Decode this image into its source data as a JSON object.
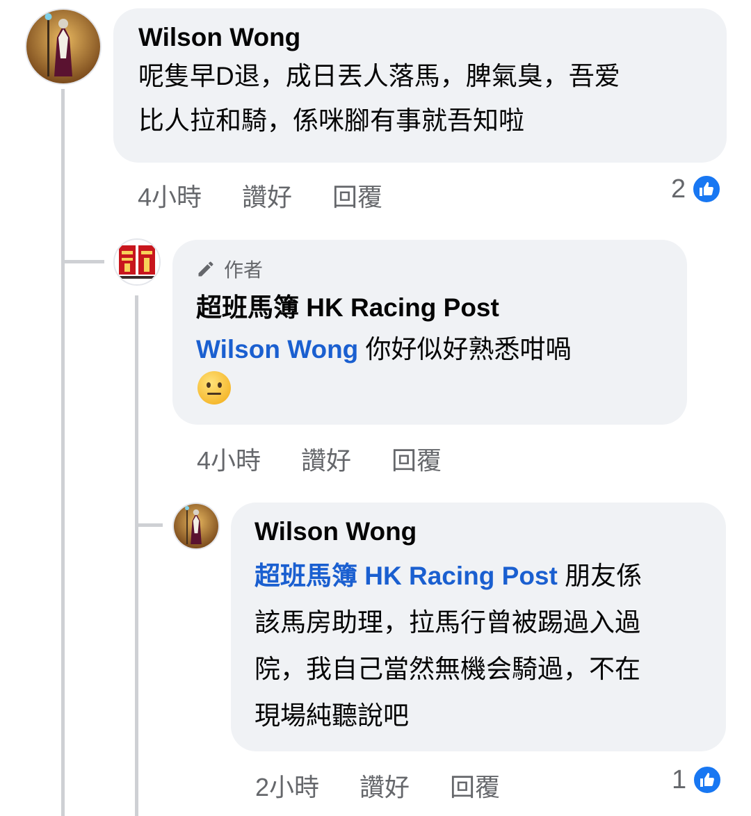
{
  "comment1": {
    "author": "Wilson Wong",
    "text_line1": "呢隻早D退，成日丟人落馬，脾氣臭，吾爱",
    "text_line2": "比人拉和騎，係咪腳有事就吾知啦",
    "time": "4小時",
    "like_label": "讚好",
    "reply_label": "回覆",
    "reaction_count": "2"
  },
  "reply1": {
    "author_badge": "作者",
    "author": "超班馬簿 HK Racing Post",
    "mention": "Wilson Wong",
    "text": " 你好似好熟悉咁喎",
    "emoji": "neutral-face",
    "time": "4小時",
    "like_label": "讚好",
    "reply_label": "回覆"
  },
  "reply2": {
    "author": "Wilson Wong",
    "mention": "超班馬簿 HK Racing Post",
    "text_line1": " 朋友係",
    "text_line2": "該馬房助理，拉馬行曾被踢過入過",
    "text_line3": "院，我自己當然無機会騎過，不在",
    "text_line4": "現場純聽說吧",
    "time": "2小時",
    "like_label": "讚好",
    "reply_label": "回覆",
    "reaction_count": "1"
  },
  "colors": {
    "bubble": "#f0f2f5",
    "mention": "#1a5fd0",
    "meta": "#65676b",
    "like": "#1877f2",
    "thread": "#ced0d4"
  }
}
